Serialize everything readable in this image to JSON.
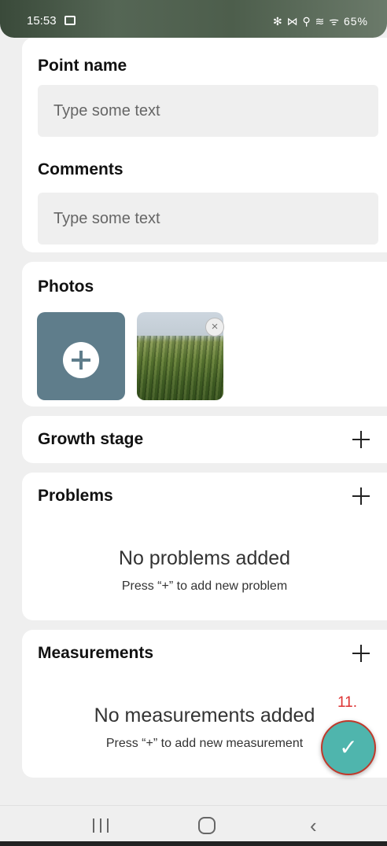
{
  "status_bar": {
    "time": "15:53",
    "indicators": "✻ ⋈ ⚲ ≋ ᯤ 65%"
  },
  "point_name": {
    "title": "Point name",
    "placeholder": "Type some text"
  },
  "comments": {
    "title": "Comments",
    "placeholder": "Type some text"
  },
  "photos": {
    "title": "Photos",
    "add_icon": "plus-icon",
    "remove_icon": "close-icon"
  },
  "growth_stage": {
    "title": "Growth stage"
  },
  "problems": {
    "title": "Problems",
    "empty_title": "No problems added",
    "empty_hint": "Press “+” to add new problem"
  },
  "measurements": {
    "title": "Measurements",
    "empty_title": "No measurements added",
    "empty_hint": "Press “+” to add new measurement"
  },
  "fab": {
    "icon": "check-icon",
    "symbol": "✓",
    "color": "#4fb5ad"
  },
  "annotation": {
    "label": "11."
  },
  "nav": {
    "back_symbol": "‹"
  }
}
